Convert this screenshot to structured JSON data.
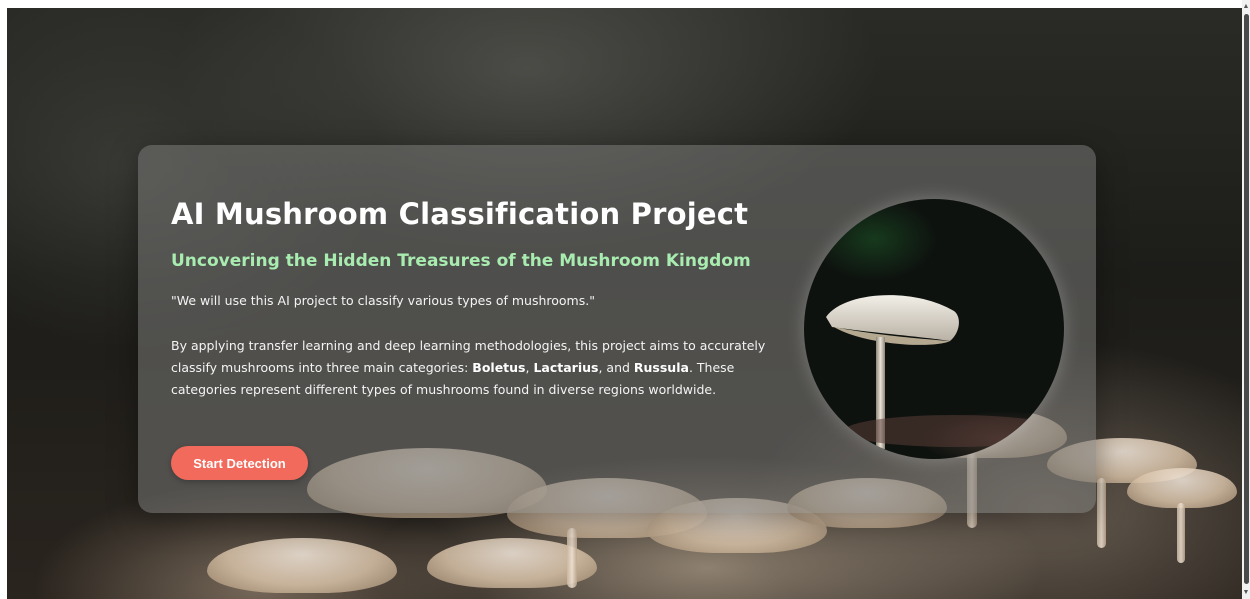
{
  "hero": {
    "title": "AI Mushroom Classification Project",
    "subtitle": "Uncovering the Hidden Treasures of the Mushroom Kingdom",
    "quote": "\"We will use this AI project to classify various types of mushrooms.\"",
    "desc_part1": "By applying transfer learning and deep learning methodologies, this project aims to accurately classify mushrooms into three main categories: ",
    "category1": "Boletus",
    "sep1": ", ",
    "category2": "Lactarius",
    "sep2": ", and ",
    "category3": "Russula",
    "desc_part2": ". These categories represent different types of mushrooms found in diverse regions worldwide.",
    "button_label": "Start Detection"
  },
  "colors": {
    "subtitle": "#a8ecb0",
    "button": "#f26a5b",
    "card": "rgba(120,120,118,0.55)"
  },
  "icons": {
    "scroll_up": "up-arrow-icon",
    "scroll_down": "down-arrow-icon"
  }
}
